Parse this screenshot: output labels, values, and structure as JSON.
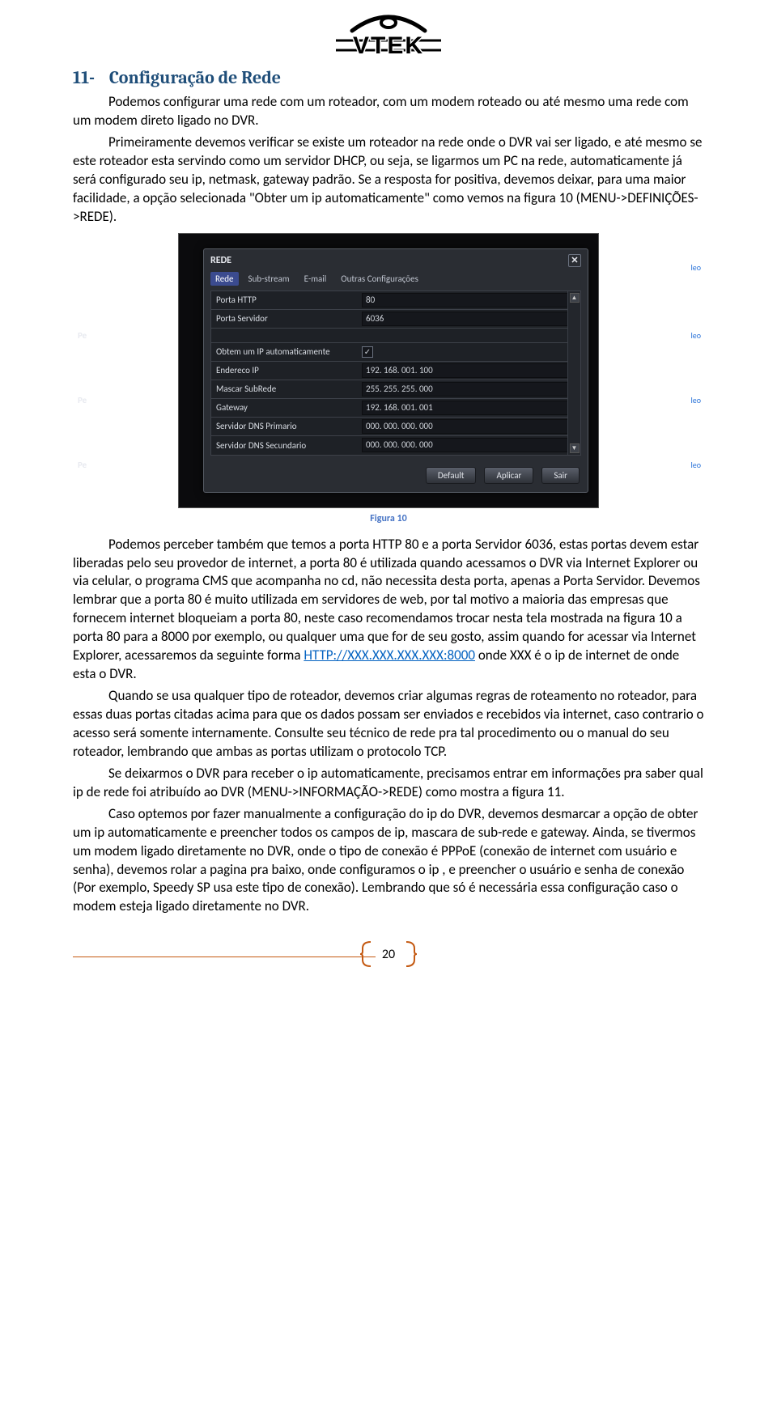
{
  "section": {
    "number": "11-",
    "title": "Configuração de Rede"
  },
  "para1": "Podemos configurar uma rede com um roteador, com um modem roteado ou até mesmo uma rede com um modem direto ligado no DVR.",
  "para2": "Primeiramente devemos verificar se existe um roteador na rede onde o DVR vai ser ligado, e até mesmo se este roteador esta servindo como um servidor DHCP, ou seja, se ligarmos um PC na rede, automaticamente já será configurado seu ip, netmask, gateway padrão. Se a resposta for positiva, devemos deixar, para uma maior facilidade, a opção selecionada \"Obter um ip automaticamente\" como vemos na figura 10 (MENU->DEFINIÇÕES->REDE).",
  "screenshot": {
    "dialog_title": "REDE",
    "close_glyph": "✕",
    "tabs": [
      "Rede",
      "Sub-stream",
      "E-mail",
      "Outras Configurações"
    ],
    "rows": [
      {
        "label": "Porta HTTP",
        "value": "80",
        "type": "text"
      },
      {
        "label": "Porta Servidor",
        "value": "6036",
        "type": "text"
      },
      {
        "label": "Obtem um IP automaticamente",
        "value": "✓",
        "type": "check"
      },
      {
        "label": "Endereco IP",
        "value": "192. 168. 001. 100",
        "type": "text"
      },
      {
        "label": "Mascar SubRede",
        "value": "255. 255. 255. 000",
        "type": "text"
      },
      {
        "label": "Gateway",
        "value": "192. 168. 001. 001",
        "type": "text"
      },
      {
        "label": "Servidor DNS Primario",
        "value": "000. 000. 000. 000",
        "type": "text"
      },
      {
        "label": "Servidor DNS Secundario",
        "value": "000. 000. 000. 000",
        "type": "text"
      }
    ],
    "buttons": [
      "Default",
      "Aplicar",
      "Sair"
    ],
    "side_labels": {
      "pe": "Pe",
      "leo": "leo"
    }
  },
  "fig_caption": "Figura 10",
  "para3a": "Podemos perceber também que temos a porta HTTP 80 e a porta Servidor 6036, estas portas devem estar liberadas pelo seu provedor de internet, a porta 80 é utilizada quando acessamos o DVR via Internet Explorer ou via celular, o programa CMS que acompanha no cd, não necessita desta porta, apenas a Porta Servidor. Devemos lembrar que a porta 80 é muito utilizada em servidores de web, por tal motivo a maioria das empresas que fornecem internet bloqueiam a porta 80, neste caso recomendamos trocar nesta tela mostrada na figura 10 a porta 80 para a 8000 por exemplo, ou qualquer uma que for de seu gosto, assim quando for acessar via Internet Explorer, acessaremos da seguinte forma ",
  "para3_link": "HTTP://XXX.XXX.XXX.XXX:8000",
  "para3b": " onde XXX é o ip de internet de onde esta o DVR.",
  "para4": "Quando se usa qualquer tipo de roteador, devemos criar algumas regras de roteamento no roteador, para essas duas portas citadas acima para que os dados possam ser enviados e recebidos via internet, caso contrario o acesso será somente internamente. Consulte seu técnico de rede pra tal procedimento ou o manual do seu roteador, lembrando que ambas as portas utilizam o protocolo TCP.",
  "para5": "Se deixarmos o DVR para receber o ip automaticamente, precisamos entrar em informações pra saber qual ip de rede foi atribuído ao DVR (MENU->INFORMAÇÃO->REDE) como mostra a figura 11.",
  "para6": "Caso optemos por fazer manualmente a configuração do ip do DVR, devemos desmarcar a opção de obter um ip automaticamente e preencher todos os campos de ip, mascara de sub-rede e gateway. Ainda, se tivermos um modem ligado diretamente no DVR, onde o tipo de conexão é PPPoE (conexão de internet com usuário e senha), devemos rolar a pagina pra baixo, onde configuramos o ip , e preencher o usuário e senha de conexão (Por exemplo, Speedy SP usa este tipo de conexão). Lembrando que só é necessária essa configuração caso o modem esteja ligado diretamente no DVR.",
  "page_number": "20"
}
